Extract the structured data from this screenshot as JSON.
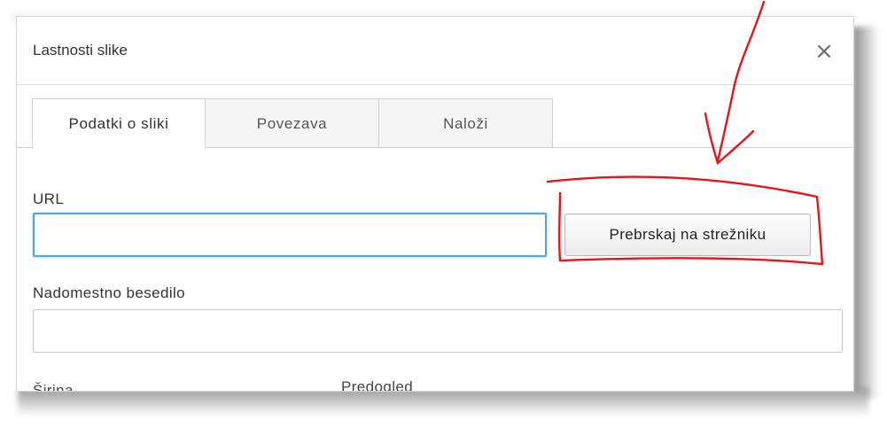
{
  "dialog": {
    "title": "Lastnosti slike",
    "close_label": "×"
  },
  "tabs": [
    {
      "label": "Podatki o sliki",
      "active": true
    },
    {
      "label": "Povezava",
      "active": false
    },
    {
      "label": "Naloži",
      "active": false
    }
  ],
  "form": {
    "url_label": "URL",
    "url_value": "",
    "browse_button_label": "Prebrskaj na strežniku",
    "alt_label": "Nadomestno besedilo",
    "alt_value": "",
    "width_label": "Širina",
    "preview_label": "Predogled"
  },
  "colors": {
    "annotation": "#e8141c",
    "focus_border": "#4ea6e3"
  },
  "icons": {
    "close": "close-icon"
  }
}
